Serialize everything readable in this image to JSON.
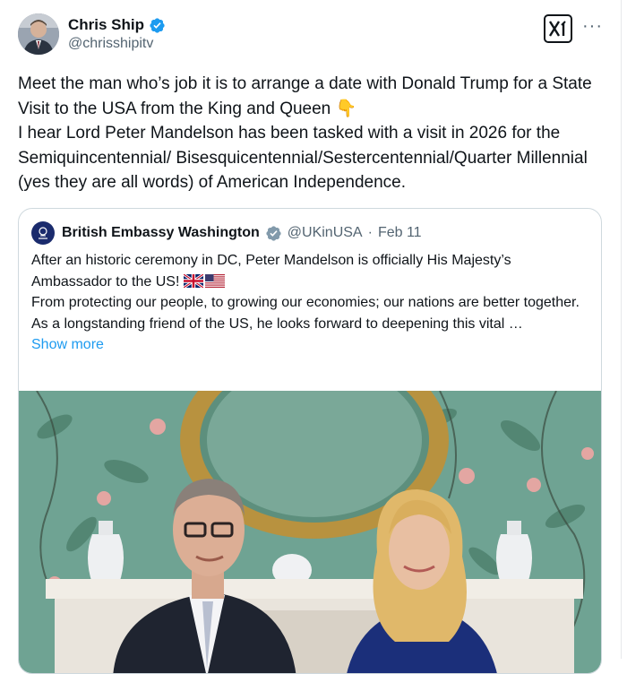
{
  "post": {
    "author_name": "Chris Ship",
    "author_handle": "@chrisshipitv",
    "text_lines": [
      "Meet the man who’s job it is to arrange a date with Donald Trump for a State Visit to the USA from the King and Queen",
      "I hear Lord Peter Mandelson has been tasked with a visit in 2026 for the Semiquincentennial/ Bisesquicentennial/Sestercentennial/Quarter Millennial (yes they are all words) of American Independence."
    ],
    "emoji_after_line1": "👇"
  },
  "quote": {
    "author_name": "British Embassy Washington",
    "author_handle": "@UKinUSA",
    "separator": "·",
    "date": "Feb 11",
    "lines": [
      "After an historic ceremony in DC, Peter Mandelson is officially His Majesty’s Ambassador to the US!",
      "From protecting our people, to growing our economies; our nations are better together.",
      "As a longstanding friend of the US, he looks forward to deepening this vital …"
    ],
    "show_more": "Show more"
  },
  "icons": {
    "verified": "verified-badge-icon",
    "more": "more-icon",
    "brand": "xi-logo-icon",
    "pointing": "pointing-down-icon",
    "uk_flag": "uk-flag-icon",
    "us_flag": "us-flag-icon"
  },
  "colors": {
    "link": "#1d9bf0",
    "secondary": "#536471",
    "text": "#0f1419"
  }
}
